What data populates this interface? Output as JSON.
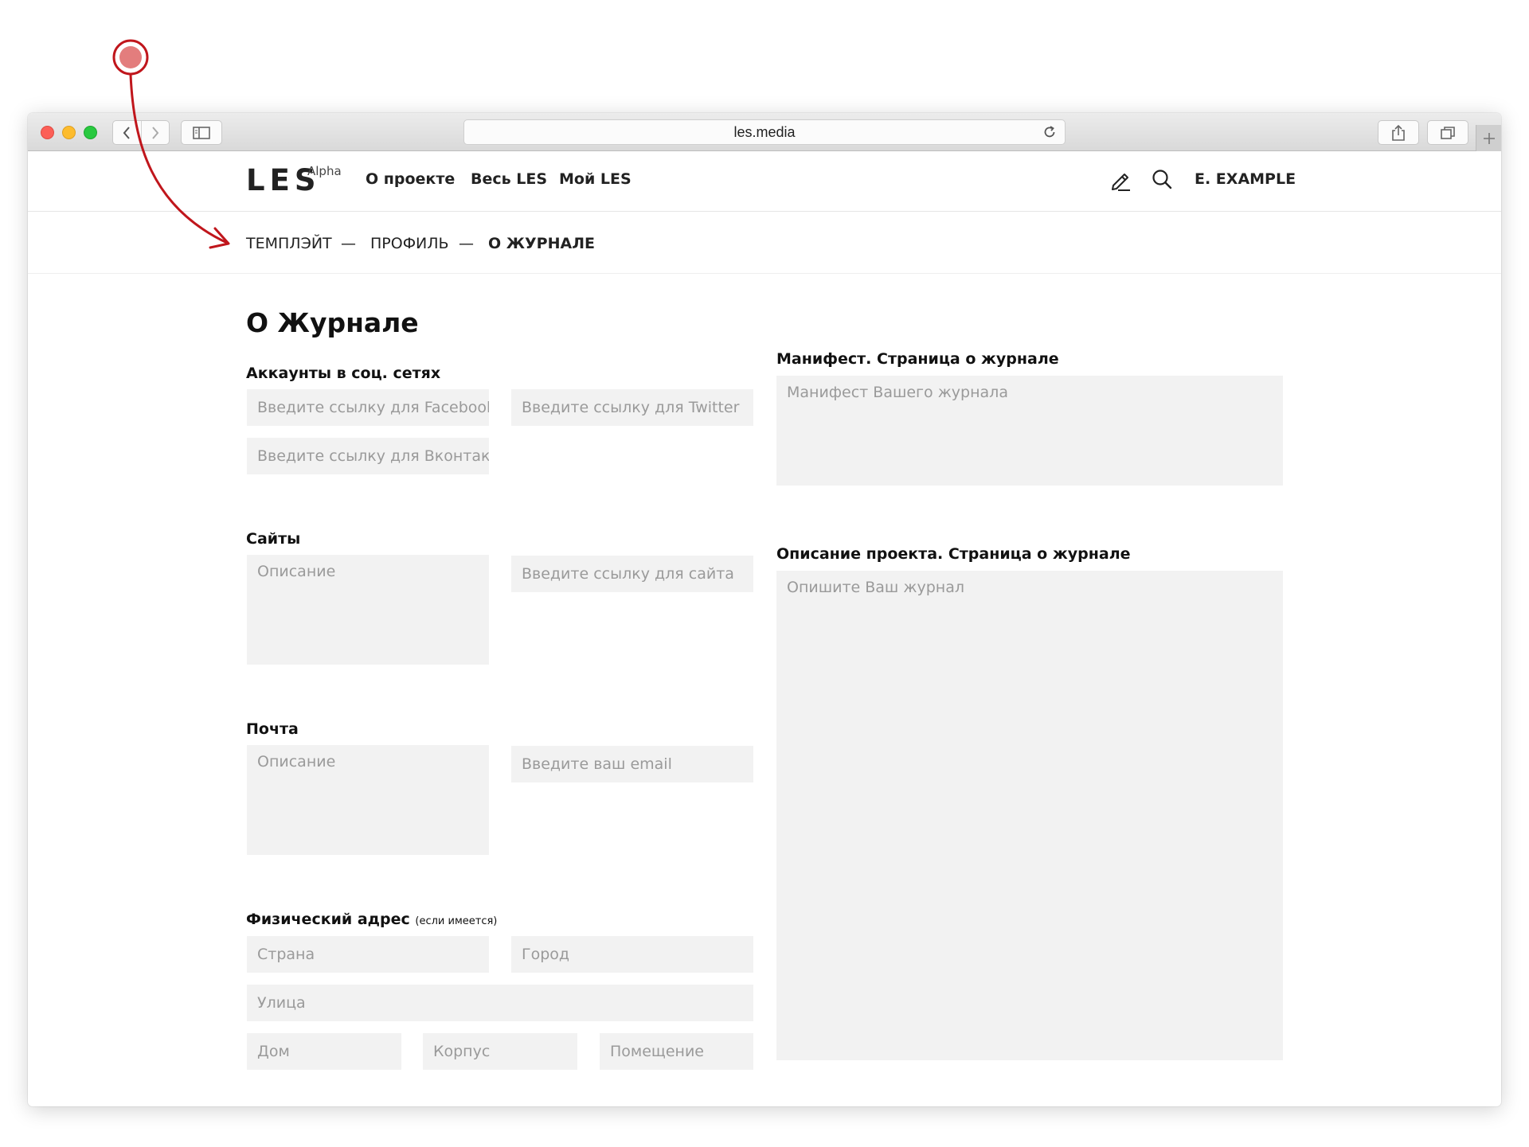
{
  "browser": {
    "url": "les.media"
  },
  "site": {
    "logo": "LES",
    "logo_badge": "Alpha",
    "nav": [
      "О проекте",
      "Весь LES",
      "Мой LES"
    ],
    "user": "E. EXAMPLE"
  },
  "breadcrumb": {
    "items": [
      "ТЕМПЛЭЙТ",
      "ПРОФИЛЬ",
      "О ЖУРНАЛЕ"
    ],
    "separator": "—"
  },
  "page": {
    "title": "О Журнале"
  },
  "social": {
    "label": "Аккаунты в соц. сетях",
    "facebook_placeholder": "Введите ссылку для Facebook",
    "twitter_placeholder": "Введите ссылку для Twitter",
    "vk_placeholder": "Введите ссылку для Вконтакте"
  },
  "sites": {
    "label": "Сайты",
    "description_placeholder": "Описание",
    "url_placeholder": "Введите ссылку для сайта"
  },
  "mail": {
    "label": "Почта",
    "description_placeholder": "Описание",
    "email_placeholder": "Введите ваш email"
  },
  "address": {
    "label": "Физический адрес",
    "label_note": "(если имеется)",
    "country_placeholder": "Страна",
    "city_placeholder": "Город",
    "street_placeholder": "Улица",
    "house_placeholder": "Дом",
    "building_placeholder": "Корпус",
    "room_placeholder": "Помещение"
  },
  "manifest": {
    "label": "Манифест. Страница о журнале",
    "placeholder": "Манифест Вашего журнала"
  },
  "project_description": {
    "label": "Описание проекта. Страница о журнале",
    "placeholder": "Опишите Ваш журнал"
  },
  "colors": {
    "annotation": "#c0161c",
    "annotation_fill": "#e37d7d",
    "field_bg": "#f2f2f2"
  }
}
